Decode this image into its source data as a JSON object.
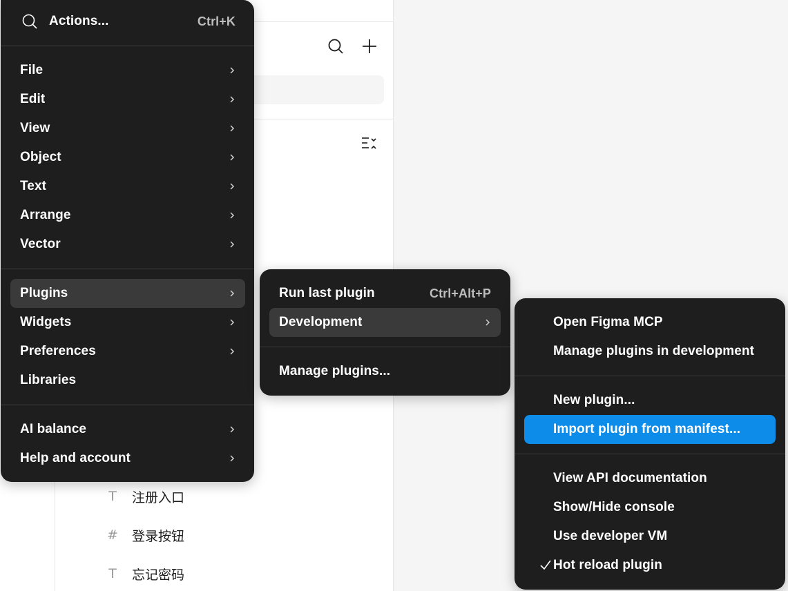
{
  "layers": [
    {
      "icon": "text-icon",
      "glyph": "T",
      "label": "注册入口"
    },
    {
      "icon": "frame-icon",
      "glyph": "#",
      "label": "登录按钮"
    },
    {
      "icon": "text-icon",
      "glyph": "T",
      "label": "忘记密码"
    }
  ],
  "main_menu": {
    "search_label": "Actions...",
    "search_shortcut": "Ctrl+K",
    "items": [
      {
        "label": "File",
        "submenu": true
      },
      {
        "label": "Edit",
        "submenu": true
      },
      {
        "label": "View",
        "submenu": true
      },
      {
        "label": "Object",
        "submenu": true
      },
      {
        "label": "Text",
        "submenu": true
      },
      {
        "label": "Arrange",
        "submenu": true
      },
      {
        "label": "Vector",
        "submenu": true
      },
      {
        "label": "Plugins",
        "submenu": true
      },
      {
        "label": "Widgets",
        "submenu": true
      },
      {
        "label": "Preferences",
        "submenu": true
      },
      {
        "label": "Libraries",
        "submenu": false
      },
      {
        "label": "AI balance",
        "submenu": true
      },
      {
        "label": "Help and account",
        "submenu": true
      }
    ]
  },
  "plugins_menu": {
    "run_last_label": "Run last plugin",
    "run_last_shortcut": "Ctrl+Alt+P",
    "development_label": "Development",
    "manage_label": "Manage plugins..."
  },
  "development_menu": {
    "items": [
      {
        "label": "Open Figma MCP"
      },
      {
        "label": "Manage plugins in development"
      },
      {
        "label": "New plugin..."
      },
      {
        "label": "Import plugin from manifest..."
      },
      {
        "label": "View API documentation"
      },
      {
        "label": "Show/Hide console"
      },
      {
        "label": "Use developer VM"
      },
      {
        "label": "Hot reload plugin",
        "checked": true
      }
    ]
  },
  "colors": {
    "menu_bg": "#1e1e1e",
    "hover": "#3a3a3a",
    "selected": "#0d8ce9"
  }
}
